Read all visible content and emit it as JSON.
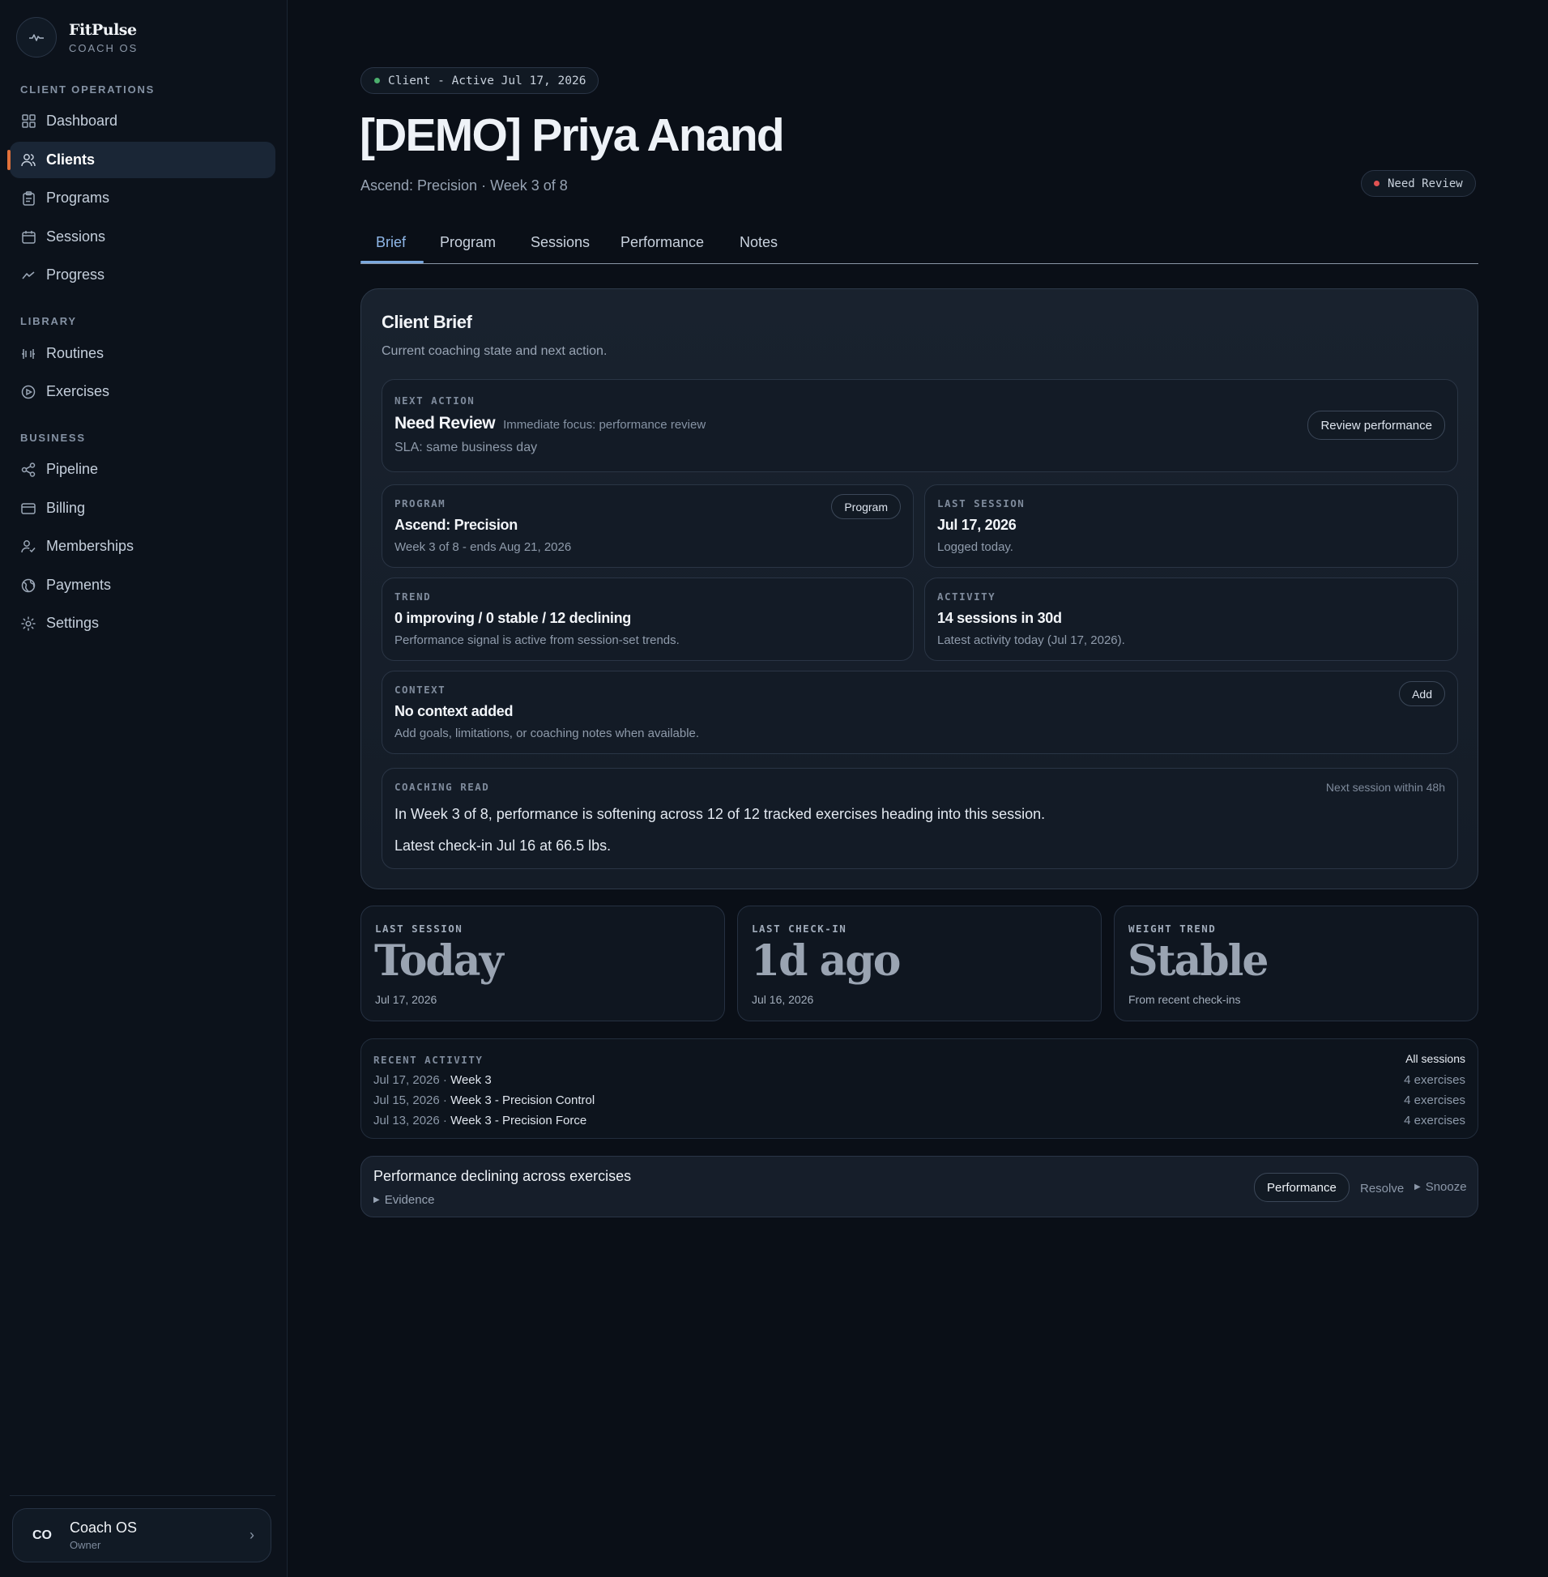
{
  "brand": {
    "name": "FitPulse",
    "subtitle": "COACH OS"
  },
  "sidebar": {
    "sections": [
      {
        "title": "CLIENT OPERATIONS"
      },
      {
        "title": "LIBRARY"
      },
      {
        "title": "BUSINESS"
      }
    ],
    "items": [
      {
        "label": "Dashboard",
        "icon": "grid-icon"
      },
      {
        "label": "Clients",
        "icon": "users-icon",
        "active": true
      },
      {
        "label": "Programs",
        "icon": "clipboard-icon"
      },
      {
        "label": "Sessions",
        "icon": "calendar-icon"
      },
      {
        "label": "Progress",
        "icon": "trend-icon"
      },
      {
        "label": "Routines",
        "icon": "dumbbell-icon"
      },
      {
        "label": "Exercises",
        "icon": "play-circle-icon"
      },
      {
        "label": "Pipeline",
        "icon": "share-icon"
      },
      {
        "label": "Billing",
        "icon": "credit-card-icon"
      },
      {
        "label": "Memberships",
        "icon": "user-check-icon"
      },
      {
        "label": "Payments",
        "icon": "globe-icon"
      },
      {
        "label": "Settings",
        "icon": "gear-icon"
      }
    ],
    "user": {
      "initials": "CO",
      "name": "Coach OS",
      "role": "Owner"
    }
  },
  "header": {
    "status": "Client - Active Jul 17, 2026",
    "title": "[DEMO] Priya Anand",
    "subtitle": "Ascend: Precision · Week 3 of 8",
    "review_badge": "Need Review"
  },
  "tabs": [
    "Brief",
    "Program",
    "Sessions",
    "Performance",
    "Notes"
  ],
  "brief": {
    "title": "Client Brief",
    "description": "Current coaching state and next action.",
    "next_action": {
      "label": "NEXT ACTION",
      "value": "Need Review",
      "focus": "Immediate focus: performance review",
      "sla": "SLA: same business day",
      "button": "Review performance"
    },
    "program": {
      "label": "PROGRAM",
      "value": "Ascend: Precision",
      "note": "Week 3 of 8 - ends Aug 21, 2026",
      "button": "Program"
    },
    "last_session": {
      "label": "LAST SESSION",
      "value": "Jul 17, 2026",
      "note": "Logged today."
    },
    "trend": {
      "label": "TREND",
      "value": "0 improving / 0 stable / 12 declining",
      "note": "Performance signal is active from session-set trends."
    },
    "activity": {
      "label": "ACTIVITY",
      "value": "14 sessions in 30d",
      "note": "Latest activity today (Jul 17, 2026)."
    },
    "context": {
      "label": "CONTEXT",
      "value": "No context added",
      "note": "Add goals, limitations, or coaching notes when available.",
      "button": "Add"
    },
    "coaching_read": {
      "label": "COACHING READ",
      "meta": "Next session within 48h",
      "line1": "In Week 3 of 8, performance is softening across 12 of 12 tracked exercises heading into this session.",
      "line2": "Latest check-in Jul 16 at 66.5 lbs."
    }
  },
  "stats": [
    {
      "label": "LAST SESSION",
      "value": "Today",
      "note": "Jul 17, 2026"
    },
    {
      "label": "LAST CHECK-IN",
      "value": "1d ago",
      "note": "Jul 16, 2026"
    },
    {
      "label": "WEIGHT TREND",
      "value": "Stable",
      "note": "From recent check-ins"
    }
  ],
  "recent_activity": {
    "label": "RECENT ACTIVITY",
    "link": "All sessions",
    "rows": [
      {
        "date": "Jul 17, 2026",
        "sep": " · ",
        "name": "Week 3",
        "count": "4 exercises"
      },
      {
        "date": "Jul 15, 2026",
        "sep": " · ",
        "name": "Week 3 - Precision Control",
        "count": "4 exercises"
      },
      {
        "date": "Jul 13, 2026",
        "sep": " · ",
        "name": "Week 3 - Precision Force",
        "count": "4 exercises"
      }
    ]
  },
  "alert": {
    "title": "Performance declining across exercises",
    "evidence": "Evidence",
    "button": "Performance",
    "resolve": "Resolve",
    "snooze": "Snooze"
  },
  "colors": {
    "accent": "#7aa8de",
    "active_marker": "#e0703a",
    "status_green": "#4caf6d",
    "status_red": "#e05252",
    "background": "#0a0f17"
  }
}
